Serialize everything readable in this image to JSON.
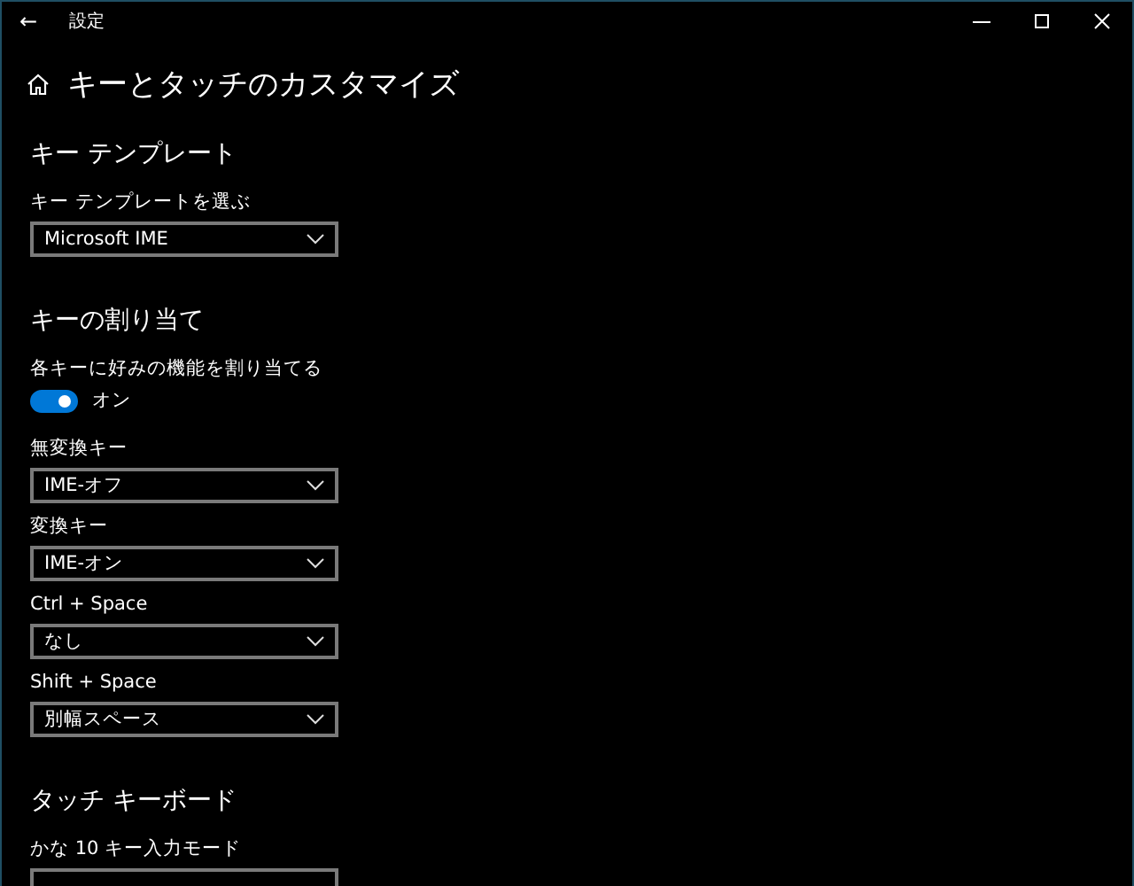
{
  "window": {
    "title": "設定",
    "back": "←"
  },
  "page": {
    "title": "キーとタッチのカスタマイズ"
  },
  "sections": [
    {
      "title": "キー テンプレート",
      "settings": [
        {
          "label": "キー テンプレートを選ぶ",
          "control": {
            "kind": "dropdown",
            "value": "Microsoft IME"
          }
        }
      ]
    },
    {
      "title": "キーの割り当て",
      "settings": [
        {
          "label": "各キーに好みの機能を割り当てる",
          "control": {
            "kind": "toggle",
            "on": true,
            "state_text": "オン"
          }
        },
        {
          "label": "無変換キー",
          "control": {
            "kind": "dropdown",
            "value": "IME-オフ"
          }
        },
        {
          "label": "変換キー",
          "control": {
            "kind": "dropdown",
            "value": "IME-オン"
          }
        },
        {
          "label": "Ctrl + Space",
          "control": {
            "kind": "dropdown",
            "value": "なし"
          }
        },
        {
          "label": "Shift + Space",
          "control": {
            "kind": "dropdown",
            "value": "別幅スペース"
          }
        }
      ]
    },
    {
      "title": "タッチ キーボード",
      "settings": [
        {
          "label": "かな 10 キー入力モード",
          "control": {
            "kind": "dropdown"
          }
        }
      ]
    }
  ]
}
